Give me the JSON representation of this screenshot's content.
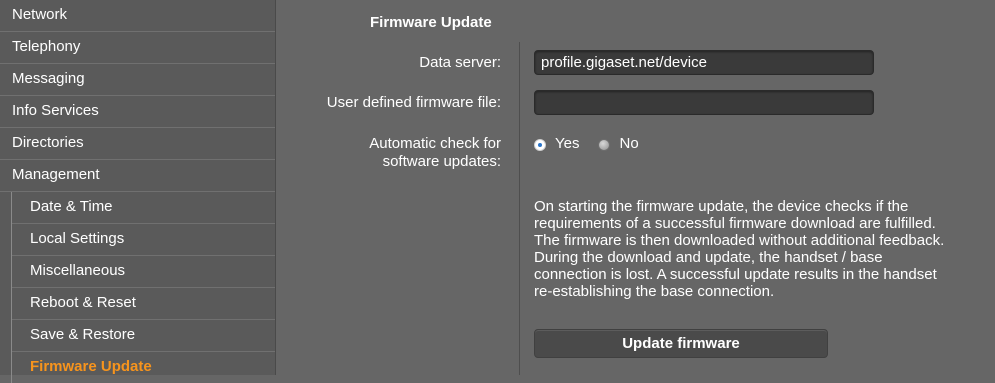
{
  "sidebar": {
    "items": [
      {
        "label": "Network"
      },
      {
        "label": "Telephony"
      },
      {
        "label": "Messaging"
      },
      {
        "label": "Info Services"
      },
      {
        "label": "Directories"
      },
      {
        "label": "Management"
      }
    ],
    "management_subitems": [
      {
        "label": "Date & Time"
      },
      {
        "label": "Local Settings"
      },
      {
        "label": "Miscellaneous"
      },
      {
        "label": "Reboot & Reset"
      },
      {
        "label": "Save & Restore"
      },
      {
        "label": "Firmware Update"
      }
    ],
    "active_color": "#f7941d"
  },
  "main": {
    "title": "Firmware Update",
    "data_server": {
      "label": "Data server:",
      "value": "profile.gigaset.net/device"
    },
    "user_firmware_file": {
      "label": "User defined firmware file:",
      "value": ""
    },
    "auto_check": {
      "label_line1": "Automatic check for",
      "label_line2": "software updates:",
      "options": [
        {
          "label": "Yes",
          "selected": true
        },
        {
          "label": "No",
          "selected": false
        }
      ]
    },
    "info_lines": [
      "On starting the firmware update, the device checks if the",
      "requirements of a successful firmware download are fulfilled.",
      "The firmware is then downloaded without additional feedback.",
      "During the download and update, the handset / base",
      "connection is lost. A successful update results in the handset",
      "re-establishing the base connection."
    ],
    "update_button_label": "Update firmware"
  }
}
